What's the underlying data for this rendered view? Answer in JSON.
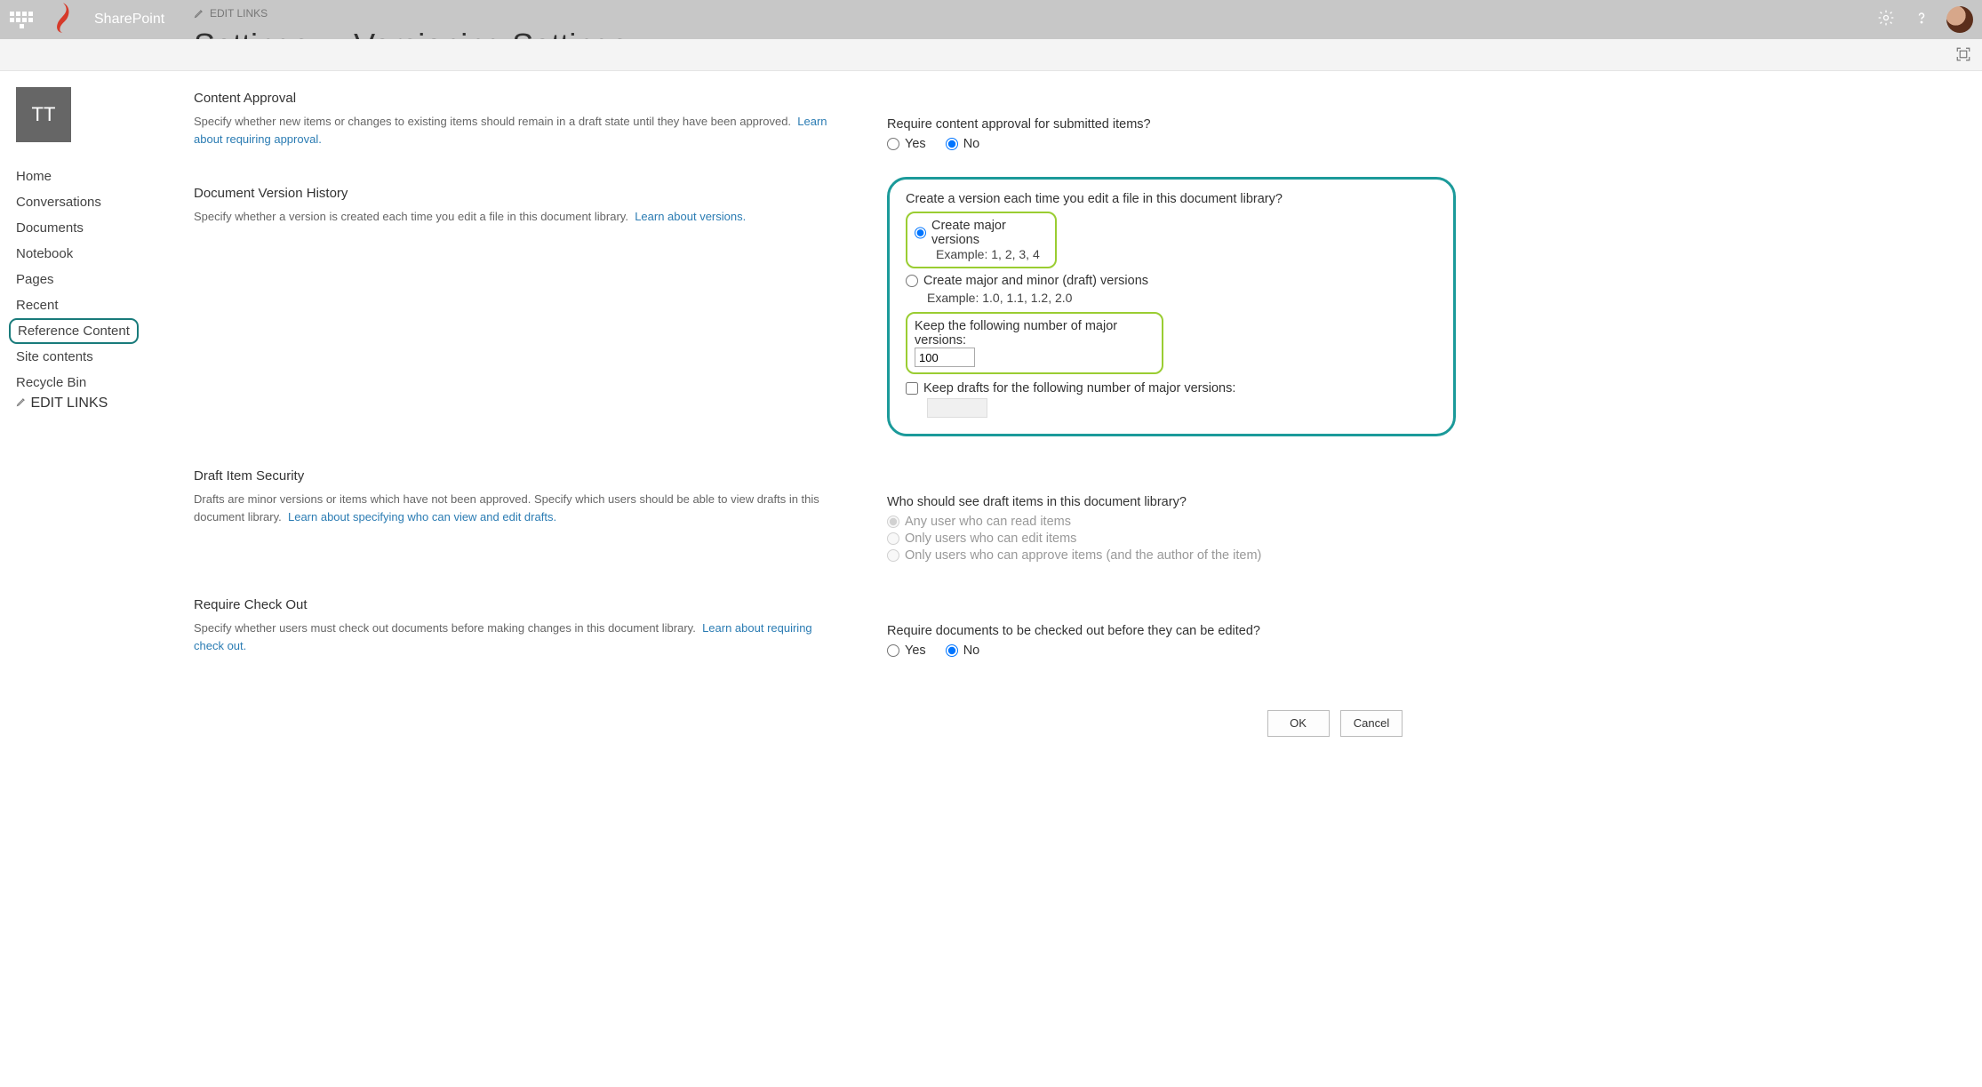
{
  "suite": {
    "title": "SharePoint"
  },
  "site": {
    "tile": "TT"
  },
  "title": {
    "edit_links": "EDIT LINKS",
    "settings": "Settings",
    "page": "Versioning Settings"
  },
  "nav": {
    "items": [
      "Home",
      "Conversations",
      "Documents",
      "Notebook",
      "Pages",
      "Recent",
      "Reference Content",
      "Site contents",
      "Recycle Bin"
    ],
    "highlighted_index": 6,
    "edit_links": "EDIT LINKS"
  },
  "sections": {
    "approval": {
      "heading": "Content Approval",
      "desc": "Specify whether new items or changes to existing items should remain in a draft state until they have been approved.",
      "link": "Learn about requiring approval.",
      "question": "Require content approval for submitted items?",
      "yes": "Yes",
      "no": "No",
      "value": "No"
    },
    "versioning": {
      "heading": "Document Version History",
      "desc": "Specify whether a version is created each time you edit a file in this document library.",
      "link": "Learn about versions.",
      "question": "Create a version each time you edit a file in this document library?",
      "opt_major": "Create major versions",
      "opt_major_ex": "Example: 1, 2, 3, 4",
      "opt_minor": "Create major and minor (draft) versions",
      "opt_minor_ex": "Example: 1.0, 1.1, 1.2, 2.0",
      "value": "major",
      "keep_major_label": "Keep the following number of major versions:",
      "keep_major_value": "100",
      "keep_drafts_label": "Keep drafts for the following number of major versions:",
      "keep_drafts_checked": false,
      "keep_drafts_value": ""
    },
    "draft_sec": {
      "heading": "Draft Item Security",
      "desc": "Drafts are minor versions or items which have not been approved. Specify which users should be able to view drafts in this document library.",
      "link": "Learn about specifying who can view and edit drafts.",
      "question": "Who should see draft items in this document library?",
      "opt1": "Any user who can read items",
      "opt2": "Only users who can edit items",
      "opt3": "Only users who can approve items (and the author of the item)"
    },
    "checkout": {
      "heading": "Require Check Out",
      "desc": "Specify whether users must check out documents before making changes in this document library.",
      "link": "Learn about requiring check out.",
      "question": "Require documents to be checked out before they can be edited?",
      "yes": "Yes",
      "no": "No",
      "value": "No"
    }
  },
  "buttons": {
    "ok": "OK",
    "cancel": "Cancel"
  }
}
